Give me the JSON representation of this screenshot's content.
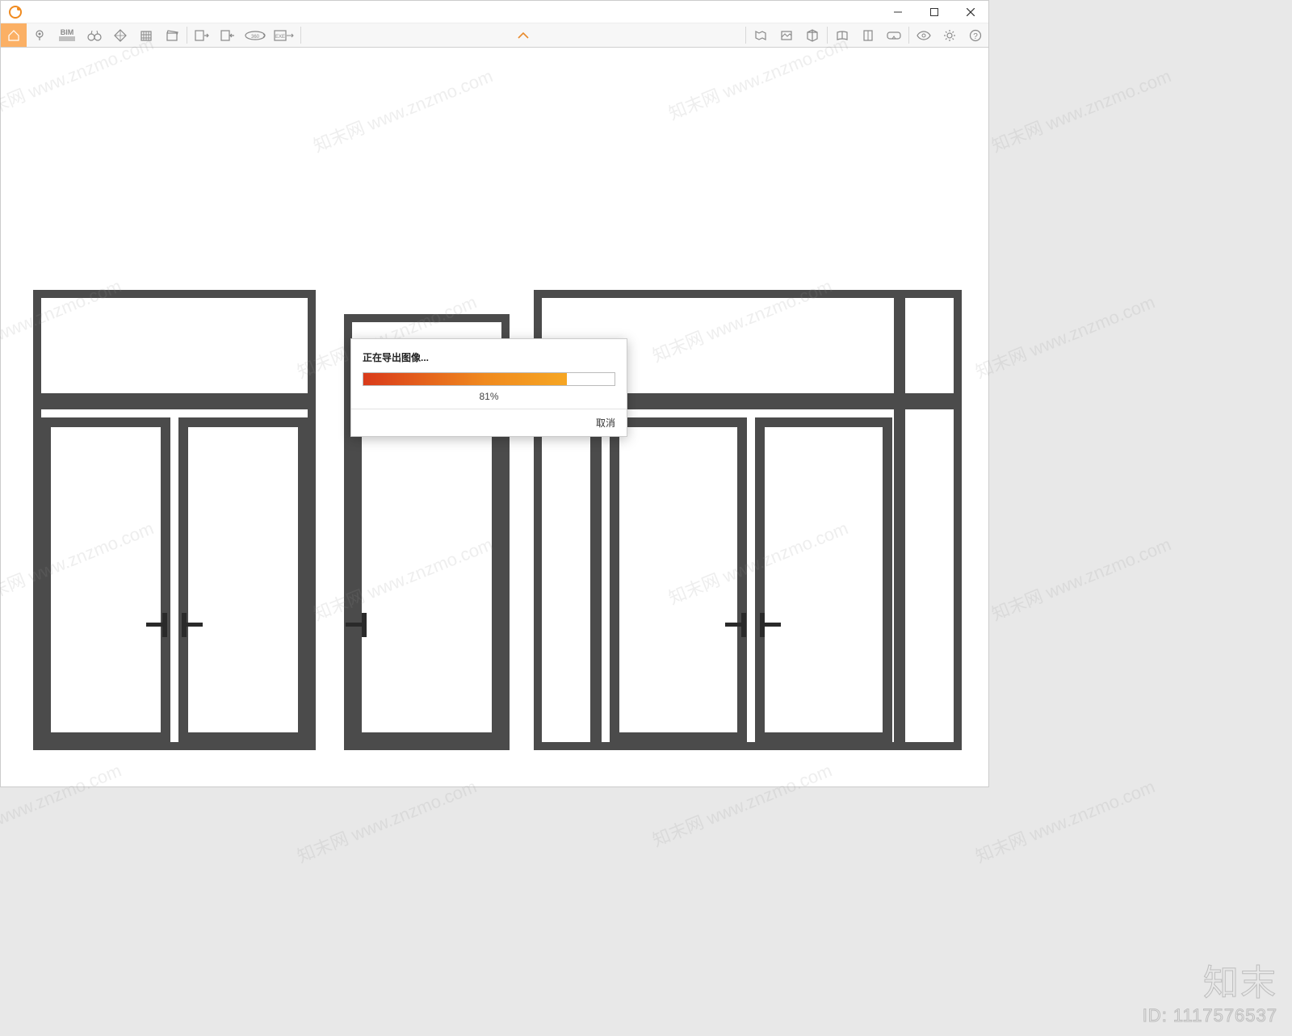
{
  "window": {
    "title": ""
  },
  "toolbar": {
    "left": [
      {
        "name": "home-icon",
        "label": "Home",
        "active": true
      },
      {
        "name": "pin-icon",
        "label": "Pin"
      },
      {
        "name": "bim-icon",
        "label": "BIM"
      },
      {
        "name": "binoculars-icon",
        "label": "View"
      },
      {
        "name": "nav-cube-icon",
        "label": "Navigation"
      },
      {
        "name": "building-icon",
        "label": "Building"
      },
      {
        "name": "clapper-icon",
        "label": "Movie"
      },
      {
        "name": "import-model-icon",
        "label": "Import"
      },
      {
        "name": "export-model-icon",
        "label": "Export"
      },
      {
        "name": "panorama-360-icon",
        "label": "360"
      },
      {
        "name": "export-exe-icon",
        "label": "EXE"
      }
    ],
    "right": [
      {
        "name": "map-icon",
        "label": "Map"
      },
      {
        "name": "screenshot-icon",
        "label": "Screenshot"
      },
      {
        "name": "cube-3d-icon",
        "label": "3D"
      },
      {
        "name": "book-open-icon",
        "label": "Book"
      },
      {
        "name": "layers-icon",
        "label": "Layers"
      },
      {
        "name": "vr-headset-icon",
        "label": "VR"
      },
      {
        "name": "eye-icon",
        "label": "Visibility"
      },
      {
        "name": "gear-icon",
        "label": "Settings"
      },
      {
        "name": "help-icon",
        "label": "Help"
      }
    ],
    "center_chevron": "⌄"
  },
  "dialog": {
    "title": "正在导出图像...",
    "percent_value": 81,
    "percent_label": "81%",
    "cancel_label": "取消"
  },
  "watermark": {
    "text": "知末网 www.znzmo.com",
    "brand": "知末",
    "id_label": "ID: 1117576537"
  }
}
